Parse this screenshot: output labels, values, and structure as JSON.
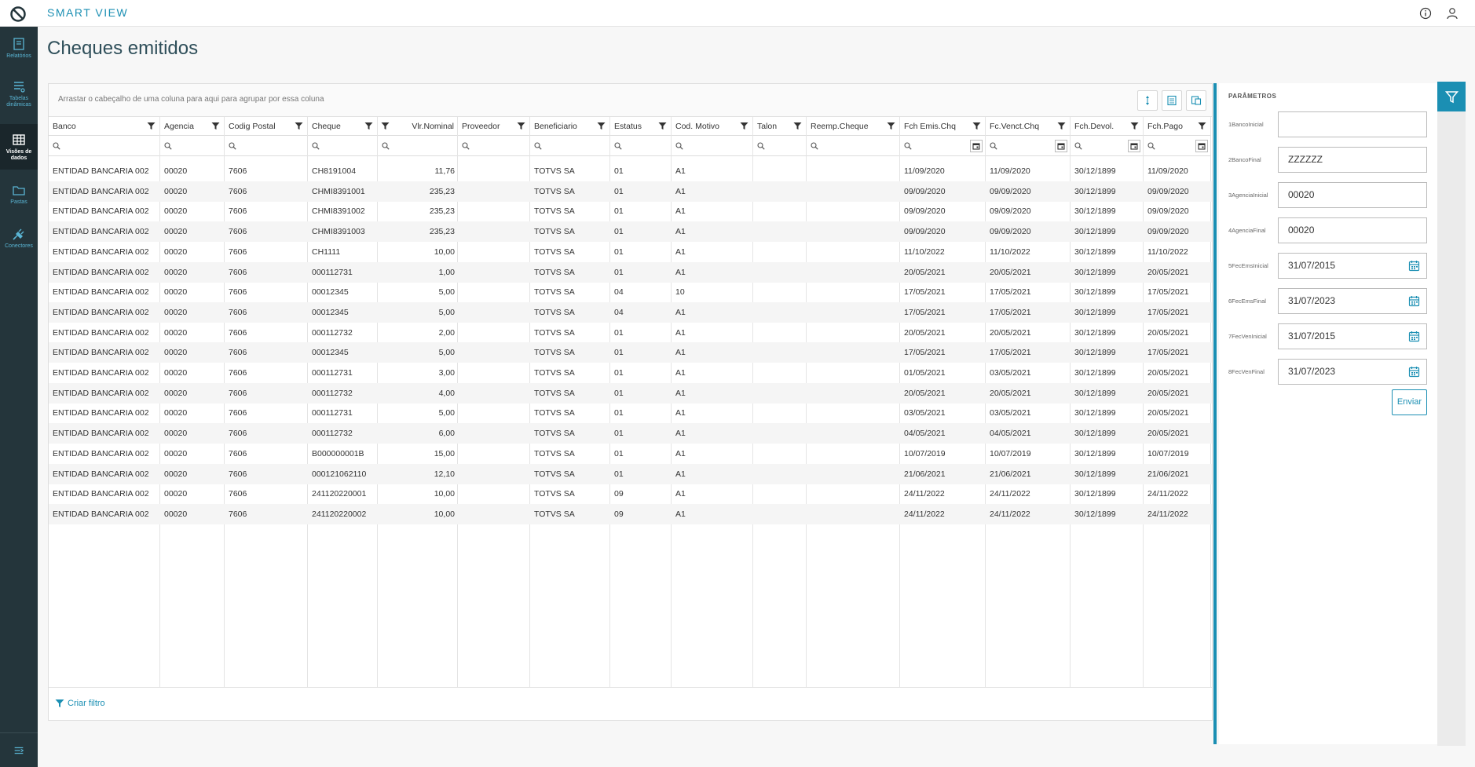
{
  "app": {
    "title": "SMART VIEW"
  },
  "page": {
    "title": "Cheques emitidos"
  },
  "sidebar": {
    "items": [
      {
        "label": "Relatórios",
        "icon": "report-icon"
      },
      {
        "label": "Tabelas dinâmicas",
        "icon": "pivot-table-icon"
      },
      {
        "label": "Visões de dados",
        "icon": "data-grid-icon"
      },
      {
        "label": "Pastas",
        "icon": "folder-icon"
      },
      {
        "label": "Conectores",
        "icon": "plug-icon"
      }
    ]
  },
  "grid": {
    "group_hint": "Arrastar o cabeçalho de uma coluna para aqui para agrupar por essa coluna",
    "footer_label": "Criar filtro",
    "columns": [
      "Banco",
      "Agencia",
      "Codig Postal",
      "Cheque",
      "Vlr.Nominal",
      "Proveedor",
      "Beneficiario",
      "Estatus",
      "Cod. Motivo",
      "Talon",
      "Reemp.Cheque",
      "Fch Emis.Chq",
      "Fc.Venct.Chq",
      "Fch.Devol.",
      "Fch.Pago"
    ],
    "rows": [
      [
        "ENTIDAD BANCARIA 002",
        "00020",
        "7606",
        "CH8191004",
        "11,76",
        "",
        "TOTVS SA",
        "01",
        "A1",
        "",
        "",
        "11/09/2020",
        "11/09/2020",
        "30/12/1899",
        "11/09/2020"
      ],
      [
        "ENTIDAD BANCARIA 002",
        "00020",
        "7606",
        "CHMI8391001",
        "235,23",
        "",
        "TOTVS SA",
        "01",
        "A1",
        "",
        "",
        "09/09/2020",
        "09/09/2020",
        "30/12/1899",
        "09/09/2020"
      ],
      [
        "ENTIDAD BANCARIA 002",
        "00020",
        "7606",
        "CHMI8391002",
        "235,23",
        "",
        "TOTVS SA",
        "01",
        "A1",
        "",
        "",
        "09/09/2020",
        "09/09/2020",
        "30/12/1899",
        "09/09/2020"
      ],
      [
        "ENTIDAD BANCARIA 002",
        "00020",
        "7606",
        "CHMI8391003",
        "235,23",
        "",
        "TOTVS SA",
        "01",
        "A1",
        "",
        "",
        "09/09/2020",
        "09/09/2020",
        "30/12/1899",
        "09/09/2020"
      ],
      [
        "ENTIDAD BANCARIA 002",
        "00020",
        "7606",
        "CH1111",
        "10,00",
        "",
        "TOTVS SA",
        "01",
        "A1",
        "",
        "",
        "11/10/2022",
        "11/10/2022",
        "30/12/1899",
        "11/10/2022"
      ],
      [
        "ENTIDAD BANCARIA 002",
        "00020",
        "7606",
        "000112731",
        "1,00",
        "",
        "TOTVS SA",
        "01",
        "A1",
        "",
        "",
        "20/05/2021",
        "20/05/2021",
        "30/12/1899",
        "20/05/2021"
      ],
      [
        "ENTIDAD BANCARIA 002",
        "00020",
        "7606",
        "00012345",
        "5,00",
        "",
        "TOTVS SA",
        "04",
        "10",
        "",
        "",
        "17/05/2021",
        "17/05/2021",
        "30/12/1899",
        "17/05/2021"
      ],
      [
        "ENTIDAD BANCARIA 002",
        "00020",
        "7606",
        "00012345",
        "5,00",
        "",
        "TOTVS SA",
        "04",
        "A1",
        "",
        "",
        "17/05/2021",
        "17/05/2021",
        "30/12/1899",
        "17/05/2021"
      ],
      [
        "ENTIDAD BANCARIA 002",
        "00020",
        "7606",
        "000112732",
        "2,00",
        "",
        "TOTVS SA",
        "01",
        "A1",
        "",
        "",
        "20/05/2021",
        "20/05/2021",
        "30/12/1899",
        "20/05/2021"
      ],
      [
        "ENTIDAD BANCARIA 002",
        "00020",
        "7606",
        "00012345",
        "5,00",
        "",
        "TOTVS SA",
        "01",
        "A1",
        "",
        "",
        "17/05/2021",
        "17/05/2021",
        "30/12/1899",
        "17/05/2021"
      ],
      [
        "ENTIDAD BANCARIA 002",
        "00020",
        "7606",
        "000112731",
        "3,00",
        "",
        "TOTVS SA",
        "01",
        "A1",
        "",
        "",
        "01/05/2021",
        "03/05/2021",
        "30/12/1899",
        "20/05/2021"
      ],
      [
        "ENTIDAD BANCARIA 002",
        "00020",
        "7606",
        "000112732",
        "4,00",
        "",
        "TOTVS SA",
        "01",
        "A1",
        "",
        "",
        "20/05/2021",
        "20/05/2021",
        "30/12/1899",
        "20/05/2021"
      ],
      [
        "ENTIDAD BANCARIA 002",
        "00020",
        "7606",
        "000112731",
        "5,00",
        "",
        "TOTVS SA",
        "01",
        "A1",
        "",
        "",
        "03/05/2021",
        "03/05/2021",
        "30/12/1899",
        "20/05/2021"
      ],
      [
        "ENTIDAD BANCARIA 002",
        "00020",
        "7606",
        "000112732",
        "6,00",
        "",
        "TOTVS SA",
        "01",
        "A1",
        "",
        "",
        "04/05/2021",
        "04/05/2021",
        "30/12/1899",
        "20/05/2021"
      ],
      [
        "ENTIDAD BANCARIA 002",
        "00020",
        "7606",
        "B000000001B",
        "15,00",
        "",
        "TOTVS SA",
        "01",
        "A1",
        "",
        "",
        "10/07/2019",
        "10/07/2019",
        "30/12/1899",
        "10/07/2019"
      ],
      [
        "ENTIDAD BANCARIA 002",
        "00020",
        "7606",
        "000121062110",
        "12,10",
        "",
        "TOTVS SA",
        "01",
        "A1",
        "",
        "",
        "21/06/2021",
        "21/06/2021",
        "30/12/1899",
        "21/06/2021"
      ],
      [
        "ENTIDAD BANCARIA 002",
        "00020",
        "7606",
        "241120220001",
        "10,00",
        "",
        "TOTVS SA",
        "09",
        "A1",
        "",
        "",
        "24/11/2022",
        "24/11/2022",
        "30/12/1899",
        "24/11/2022"
      ],
      [
        "ENTIDAD BANCARIA 002",
        "00020",
        "7606",
        "241120220002",
        "10,00",
        "",
        "TOTVS SA",
        "09",
        "A1",
        "",
        "",
        "24/11/2022",
        "24/11/2022",
        "30/12/1899",
        "24/11/2022"
      ]
    ]
  },
  "params": {
    "title": "PARÂMETROS",
    "fields": [
      {
        "label": "1BancoInicial",
        "value": "",
        "type": "text"
      },
      {
        "label": "2BancoFinal",
        "value": "ZZZZZZ",
        "type": "text"
      },
      {
        "label": "3AgenciaInicial",
        "value": "00020",
        "type": "text"
      },
      {
        "label": "4AgenciaFinal",
        "value": "00020",
        "type": "text"
      },
      {
        "label": "5FecEmsInicial",
        "value": "31/07/2015",
        "type": "date"
      },
      {
        "label": "6FecEmsFinal",
        "value": "31/07/2023",
        "type": "date"
      },
      {
        "label": "7FecVenInicial",
        "value": "31/07/2015",
        "type": "date"
      },
      {
        "label": "8FecVenFinal",
        "value": "31/07/2023",
        "type": "date"
      }
    ],
    "submit_label": "Enviar"
  },
  "colors": {
    "accent": "#1b8fb3",
    "sidebar": "#24353b"
  }
}
